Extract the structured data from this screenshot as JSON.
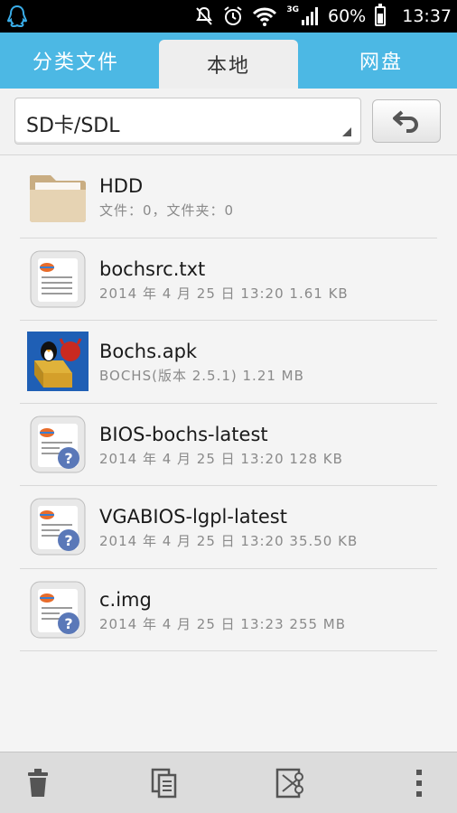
{
  "status_bar": {
    "network": "3G",
    "battery": "60%",
    "time": "13:37",
    "battery_level": 0.6
  },
  "tabs": [
    {
      "label": "分类文件"
    },
    {
      "label": "本地"
    },
    {
      "label": "网盘"
    }
  ],
  "path_bar": {
    "path": "SD卡/SDL"
  },
  "files": [
    {
      "name": "HDD",
      "meta": "文件：0，文件夹：0",
      "icon": "folder-icon"
    },
    {
      "name": "bochsrc.txt",
      "meta": "2014 年 4 月 25 日 13:20 1.61 KB",
      "icon": "text-file-icon"
    },
    {
      "name": "Bochs.apk",
      "meta": "BOCHS(版本 2.5.1) 1.21 MB",
      "icon": "bochs-app-icon"
    },
    {
      "name": "BIOS-bochs-latest",
      "meta": "2014 年 4 月 25 日 13:20 128 KB",
      "icon": "unknown-file-icon"
    },
    {
      "name": "VGABIOS-lgpl-latest",
      "meta": "2014 年 4 月 25 日 13:20 35.50 KB",
      "icon": "unknown-file-icon"
    },
    {
      "name": "c.img",
      "meta": "2014 年 4 月 25 日 13:23 255 MB",
      "icon": "unknown-file-icon"
    }
  ],
  "bottom_bar": {
    "actions": [
      "trash-icon",
      "copy-icon",
      "cut-icon",
      "more-icon"
    ]
  }
}
